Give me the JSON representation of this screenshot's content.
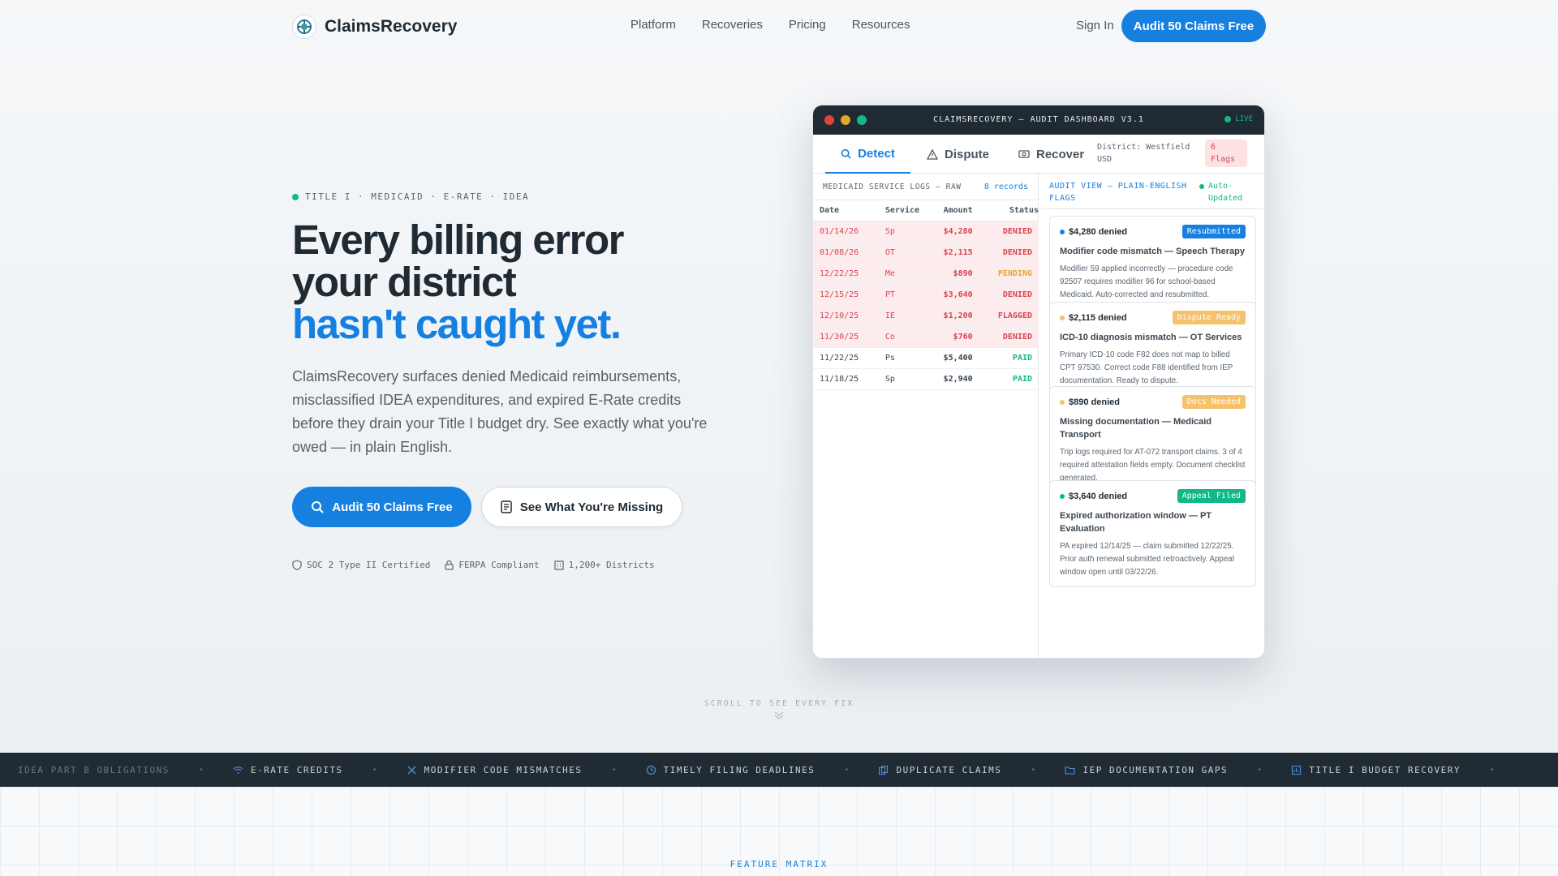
{
  "nav": {
    "brand": "ClaimsRecovery",
    "links": [
      "Platform",
      "Recoveries",
      "Pricing",
      "Resources"
    ],
    "signin": "Sign In",
    "cta": "Audit 50 Claims Free"
  },
  "hero": {
    "eyebrow": "TITLE I · MEDICAID · E-RATE · IDEA",
    "headline_line1": "Every billing error",
    "headline_line2": "your district",
    "headline_accent": "hasn't caught yet.",
    "lede": "ClaimsRecovery surfaces denied Medicaid reimbursements, misclassified IDEA expenditures, and expired E-Rate credits before they drain your Title I budget dry. See exactly what you're owed — in plain English.",
    "primary_cta": "Audit 50 Claims Free",
    "secondary_cta": "See What You're Missing",
    "trust": [
      "SOC 2 Type II Certified",
      "FERPA Compliant",
      "1,200+ Districts"
    ]
  },
  "dashboard": {
    "title": "CLAIMSRECOVERY — AUDIT DASHBOARD V3.1",
    "live": "LIVE",
    "tabs": [
      "Detect",
      "Dispute",
      "Recover"
    ],
    "district": "District: Westfield USD",
    "flags": "6 Flags",
    "logs": {
      "title": "MEDICAID SERVICE LOGS — RAW",
      "count": "8 records",
      "headers": [
        "Date",
        "Service",
        "Amount",
        "Status"
      ],
      "rows": [
        {
          "date": "01/14/26",
          "svc": "Sp",
          "amount": "$4,280",
          "status": "DENIED",
          "kind": "bad"
        },
        {
          "date": "01/08/26",
          "svc": "OT",
          "amount": "$2,115",
          "status": "DENIED",
          "kind": "bad"
        },
        {
          "date": "12/22/25",
          "svc": "Me",
          "amount": "$890",
          "status": "PENDING",
          "kind": "bad pending"
        },
        {
          "date": "12/15/25",
          "svc": "PT",
          "amount": "$3,640",
          "status": "DENIED",
          "kind": "bad"
        },
        {
          "date": "12/10/25",
          "svc": "IE",
          "amount": "$1,200",
          "status": "FLAGGED",
          "kind": "bad"
        },
        {
          "date": "11/30/25",
          "svc": "Co",
          "amount": "$760",
          "status": "DENIED",
          "kind": "bad"
        },
        {
          "date": "11/22/25",
          "svc": "Ps",
          "amount": "$5,400",
          "status": "PAID",
          "kind": "ok"
        },
        {
          "date": "11/18/25",
          "svc": "Sp",
          "amount": "$2,940",
          "status": "PAID",
          "kind": "ok"
        }
      ]
    },
    "audit": {
      "title": "AUDIT VIEW — PLAIN-ENGLISH FLAGS",
      "auto": "Auto-Updated",
      "cards": [
        {
          "amount": "$4,280 denied",
          "badge": "Resubmitted",
          "badge_color": "#1680e0",
          "dot": "#1680e0",
          "title": "Modifier code mismatch — Speech Therapy",
          "body": "Modifier 59 applied incorrectly — procedure code 92507 requires modifier 96 for school-based Medicaid. Auto-corrected and resubmitted."
        },
        {
          "amount": "$2,115 denied",
          "badge": "Dispute Ready",
          "badge_color": "#f5c16c",
          "dot": "#f5c16c",
          "title": "ICD-10 diagnosis mismatch — OT Services",
          "body": "Primary ICD-10 code F82 does not map to billed CPT 97530. Correct code F88 identified from IEP documentation. Ready to dispute."
        },
        {
          "amount": "$890 denied",
          "badge": "Docs Needed",
          "badge_color": "#f5c16c",
          "dot": "#f5c16c",
          "title": "Missing documentation — Medicaid Transport",
          "body": "Trip logs required for AT-072 transport claims. 3 of 4 required attestation fields empty. Document checklist generated."
        },
        {
          "amount": "$3,640 denied",
          "badge": "Appeal Filed",
          "badge_color": "#12b886",
          "dot": "#12b886",
          "title": "Expired authorization window — PT Evaluation",
          "body": "PA expired 12/14/25 — claim submitted 12/22/25. Prior auth renewal submitted retroactively. Appeal window open until 03/22/26."
        }
      ]
    }
  },
  "scroll_cue": "SCROLL TO SEE EVERY FIX",
  "ticker": [
    "IDEA PART B OBLIGATIONS",
    "E-RATE CREDITS",
    "MODIFIER CODE MISMATCHES",
    "TIMELY FILING DEADLINES",
    "DUPLICATE CLAIMS",
    "IEP DOCUMENTATION GAPS",
    "TITLE I BUDGET RECOVERY"
  ],
  "section_label": "FEATURE MATRIX"
}
